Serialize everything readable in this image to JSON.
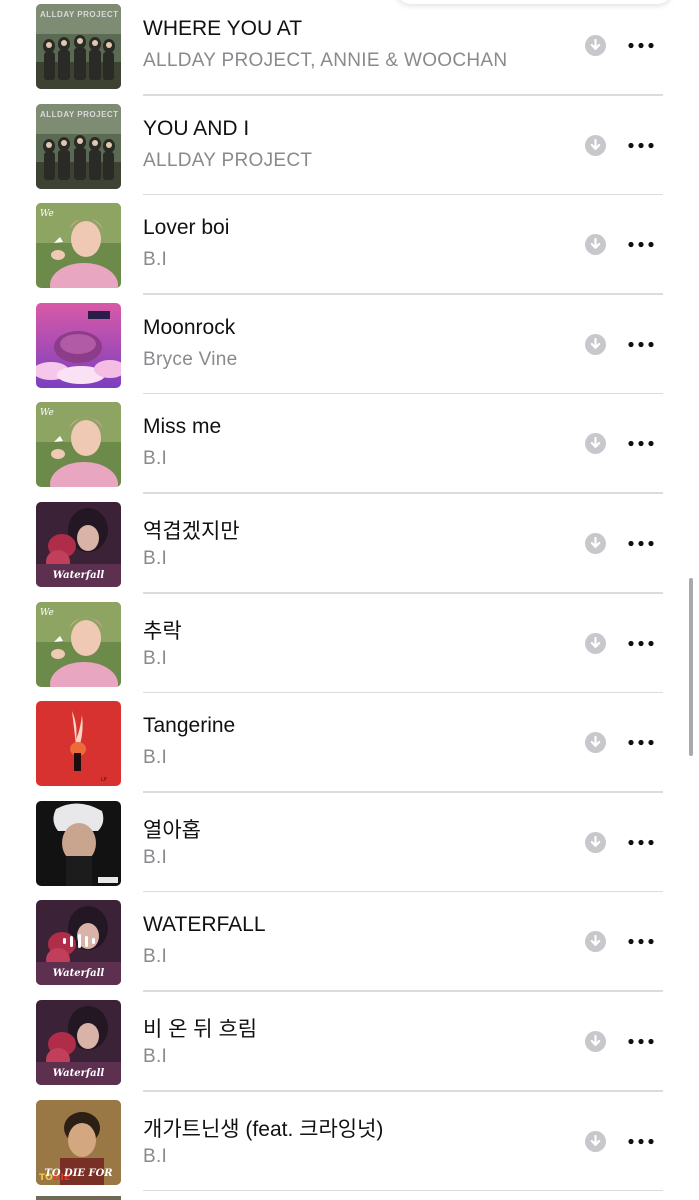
{
  "tracks": [
    {
      "title": "WHERE YOU AT",
      "artist": "ALLDAY PROJECT, ANNIE & WOOCHAN",
      "art": "allday",
      "art_caption": "ALLDAY PROJECT"
    },
    {
      "title": "YOU AND I",
      "artist": "ALLDAY PROJECT",
      "art": "allday",
      "art_caption": "ALLDAY PROJECT"
    },
    {
      "title": "Lover boi",
      "artist": "B.I",
      "art": "wonderland"
    },
    {
      "title": "Moonrock",
      "artist": "Bryce Vine",
      "art": "moonrock"
    },
    {
      "title": "Miss me",
      "artist": "B.I",
      "art": "wonderland"
    },
    {
      "title": "역겹겠지만",
      "artist": "B.I",
      "art": "waterfall",
      "art_text": "Waterfall"
    },
    {
      "title": "추락",
      "artist": "B.I",
      "art": "wonderland"
    },
    {
      "title": "Tangerine",
      "artist": "B.I",
      "art": "tangerine"
    },
    {
      "title": "열아홉",
      "artist": "B.I",
      "art": "nineteen"
    },
    {
      "title": "WATERFALL",
      "artist": "B.I",
      "art": "waterfall",
      "art_text": "Waterfall",
      "now_playing": true
    },
    {
      "title": "비 온 뒤 흐림",
      "artist": "B.I",
      "art": "waterfall",
      "art_text": "Waterfall"
    },
    {
      "title": "개가트닌생 (feat. 크라잉넛)",
      "artist": "B.I",
      "art": "tdf",
      "art_text": "TO DIE FOR"
    }
  ],
  "icons": {
    "download": "download-arrow-circle-icon",
    "more": "ellipsis-icon",
    "now_playing": "now-playing-bars-icon"
  },
  "colors": {
    "title": "#111111",
    "subtitle": "#8a8a8e",
    "separator": "#dcdcdf",
    "download_icon": "#c7c7cc",
    "more_icon": "#111111"
  }
}
